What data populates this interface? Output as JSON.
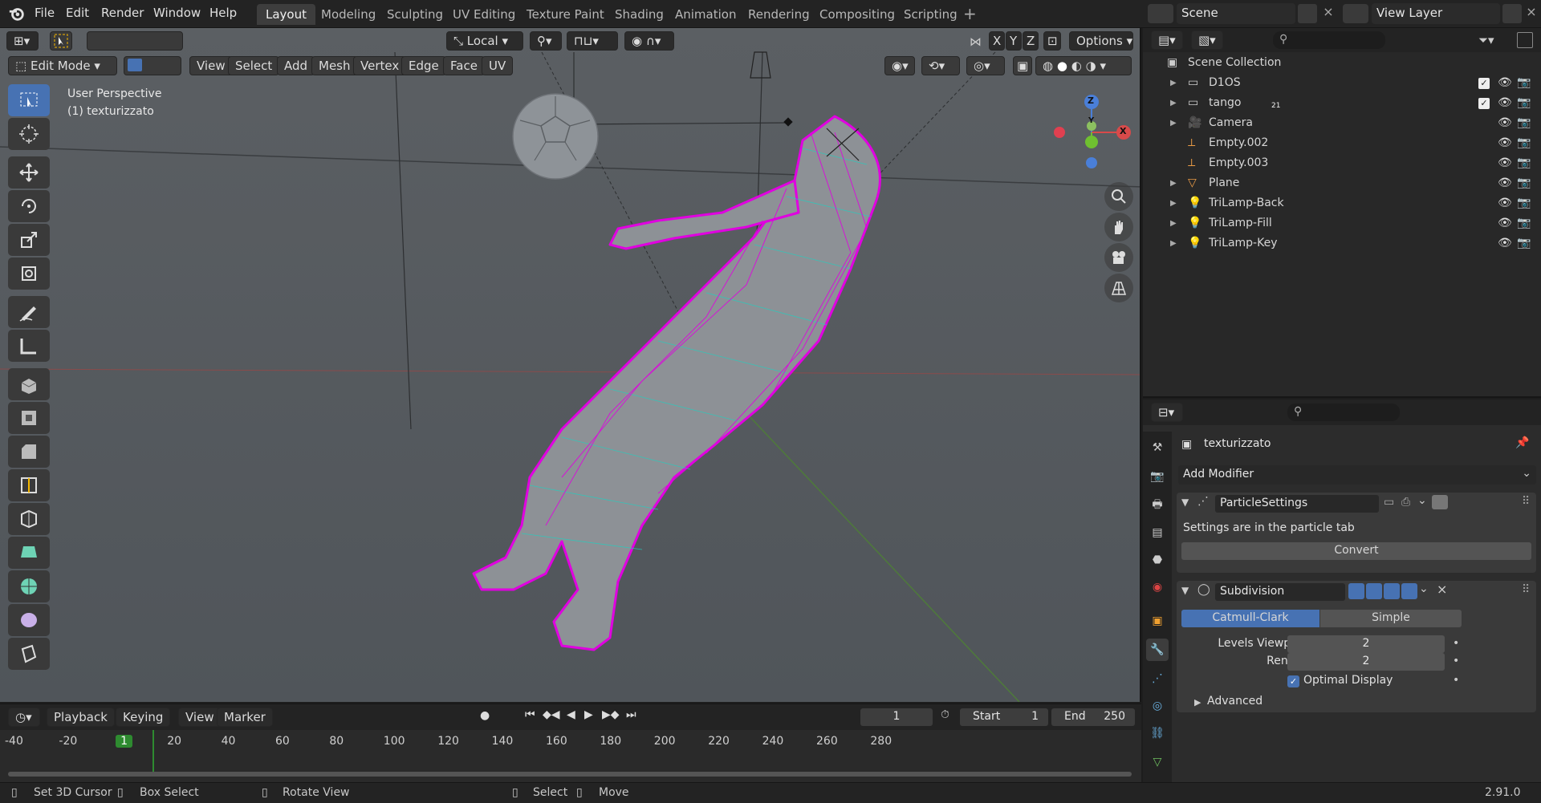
{
  "topbar": {
    "menu": [
      "File",
      "Edit",
      "Render",
      "Window",
      "Help"
    ],
    "workspaces": [
      "Layout",
      "Modeling",
      "Sculpting",
      "UV Editing",
      "Texture Paint",
      "Shading",
      "Animation",
      "Rendering",
      "Compositing",
      "Scripting"
    ],
    "active_workspace": "Layout",
    "scene_label": "Scene",
    "view_layer_label": "View Layer"
  },
  "viewport": {
    "transform_orientation": "Local",
    "options_label": "Options",
    "mode": "Edit Mode",
    "header_menus": [
      "View",
      "Select",
      "Add",
      "Mesh",
      "Vertex",
      "Edge",
      "Face",
      "UV"
    ],
    "axis_buttons": [
      "X",
      "Y",
      "Z"
    ],
    "overlay_title": "User Perspective",
    "overlay_object": "(1) texturizzato",
    "gizmo_axes": {
      "z": "Z",
      "y": "Y",
      "x": "X"
    }
  },
  "outliner": {
    "root": "Scene Collection",
    "items": [
      {
        "name": "D1OS",
        "kind": "collection"
      },
      {
        "name": "tango",
        "kind": "collection"
      },
      {
        "name": "Camera",
        "kind": "camera"
      },
      {
        "name": "Empty.002",
        "kind": "empty"
      },
      {
        "name": "Empty.003",
        "kind": "empty"
      },
      {
        "name": "Plane",
        "kind": "mesh"
      },
      {
        "name": "TriLamp-Back",
        "kind": "light"
      },
      {
        "name": "TriLamp-Fill",
        "kind": "light"
      },
      {
        "name": "TriLamp-Key",
        "kind": "light"
      }
    ],
    "tango_badge": "21"
  },
  "properties": {
    "object_name": "texturizzato",
    "add_modifier": "Add Modifier",
    "particle_modifier": {
      "name": "ParticleSettings",
      "info": "Settings are in the particle tab",
      "convert_label": "Convert"
    },
    "subdivision_modifier": {
      "name": "Subdivision",
      "types": [
        "Catmull-Clark",
        "Simple"
      ],
      "active_type": "Catmull-Clark",
      "levels_viewport_label": "Levels Viewport",
      "levels_viewport_value": "2",
      "render_label": "Render",
      "render_value": "2",
      "optimal_display_label": "Optimal Display",
      "optimal_display": true,
      "advanced_label": "Advanced"
    }
  },
  "timeline": {
    "menus": [
      "Playback",
      "Keying",
      "View",
      "Marker"
    ],
    "current_frame": "1",
    "start_label": "Start",
    "start_value": "1",
    "end_label": "End",
    "end_value": "250",
    "ticks": [
      "-40",
      "-20",
      "1",
      "20",
      "40",
      "60",
      "80",
      "100",
      "120",
      "140",
      "160",
      "180",
      "200",
      "220",
      "240",
      "260",
      "280"
    ]
  },
  "statusbar": {
    "items": [
      "Set 3D Cursor",
      "Box Select",
      "Rotate View",
      "Select",
      "Move"
    ],
    "version": "2.91.0"
  },
  "colors": {
    "accent": "#4772b3",
    "mesh_selected": "#e000e0",
    "mesh_edges": "#20d0c0",
    "frame_marker": "#2e8b30"
  }
}
